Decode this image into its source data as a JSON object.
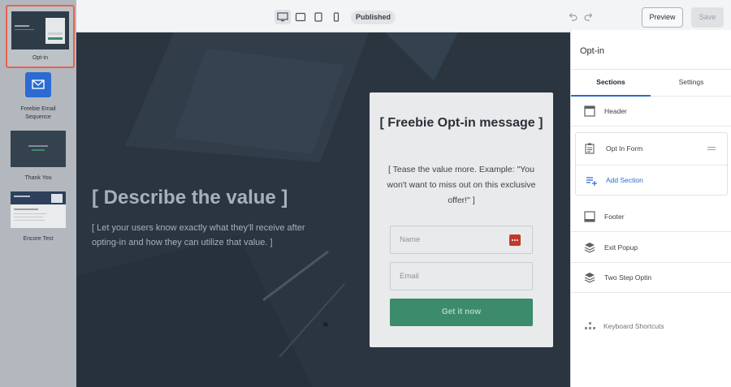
{
  "toolbar": {
    "devices": [
      "desktop-icon",
      "tablet-landscape-icon",
      "tablet-icon",
      "mobile-icon"
    ],
    "status_badge": "Published",
    "preview_label": "Preview",
    "save_label": "Save"
  },
  "steps": [
    {
      "label": "Opt-in",
      "active": true
    },
    {
      "label": "Freebie Email Sequence"
    },
    {
      "label": "Thank You"
    },
    {
      "label": "Encore Test"
    }
  ],
  "canvas": {
    "hero_title": "[ Describe the value ]",
    "hero_sub": "[ Let your users know exactly what they'll receive after opting-in and how they can utilize that value. ]",
    "form_title": "[ Freebie Opt-in message ]",
    "form_tease": "[ Tease the value more. Example: \"You won't want to miss out on this exclusive offer!\" ]",
    "name_placeholder": "Name",
    "email_placeholder": "Email",
    "cta_label": "Get it now"
  },
  "panel": {
    "title": "Opt-in",
    "tabs": [
      "Sections",
      "Settings"
    ],
    "active_tab": "Sections",
    "sections": {
      "header": "Header",
      "optin_form": "Opt In Form",
      "add_section": "Add Section",
      "footer": "Footer",
      "exit_popup": "Exit Popup",
      "two_step": "Two Step Optin"
    },
    "keyboard_shortcuts": "Keyboard Shortcuts"
  },
  "colors": {
    "accent": "#2c6bd1",
    "active_step_border": "#e8624d",
    "cta": "#3c8b6c",
    "canvas_bg": "#2b3642"
  }
}
